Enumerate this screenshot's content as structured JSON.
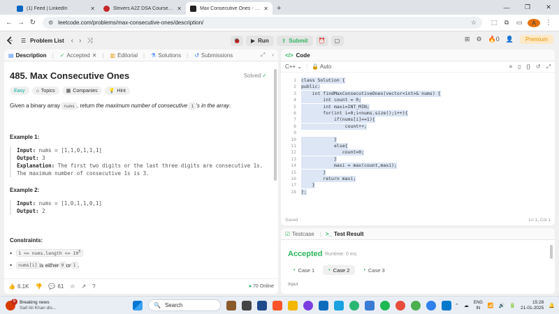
{
  "browser": {
    "tabs": [
      {
        "title": "(1) Feed | LinkedIn",
        "color": "#0a66c2"
      },
      {
        "title": "Strivers A2Z DSA Course/Sheet",
        "color": "#c62828"
      },
      {
        "title": "Max Consecutive Ones - LeetCo",
        "color": "#222222"
      }
    ],
    "url": "leetcode.com/problems/max-consecutive-ones/description/",
    "profile_initial": "A"
  },
  "nav": {
    "problem_list": "Problem List",
    "run": "Run",
    "submit": "Submit",
    "fire_count": "0",
    "premium": "Premium"
  },
  "left_tabs": {
    "description": "Description",
    "accepted": "Accepted",
    "editorial": "Editorial",
    "solutions": "Solutions",
    "submissions": "Submissions"
  },
  "problem": {
    "title": "485. Max Consecutive Ones",
    "status": "Solved",
    "difficulty": "Easy",
    "topics": "Topics",
    "companies": "Companies",
    "hint": "Hint",
    "desc_pre": "Given a binary array ",
    "desc_code": "nums",
    "desc_mid": ", return ",
    "desc_italic_a": "the maximum number of consecutive ",
    "desc_code2": "1",
    "desc_italic_b": "'s in the array",
    "desc_end": ".",
    "example1_title": "Example 1:",
    "example1_input_label": "Input:",
    "example1_input": " nums = [1,1,0,1,1,1]",
    "example1_output_label": "Output:",
    "example1_output": " 3",
    "example1_expl_label": "Explanation:",
    "example1_expl1": " The first two digits or the last three digits are consecutive 1s.",
    "example1_expl2": "The maximum number of consecutive 1s is 3.",
    "example2_title": "Example 2:",
    "example2_input_label": "Input:",
    "example2_input": " nums = [1,0,1,1,0,1]",
    "example2_output_label": "Output:",
    "example2_output": " 2",
    "constraints_title": "Constraints:",
    "constraint1": "1 <= nums.length <= 10",
    "constraint1_exp": "5",
    "constraint2_code": "nums[i]",
    "constraint2_mid": " is either ",
    "constraint2_a": "0",
    "constraint2_or": " or ",
    "constraint2_b": "1",
    "constraint2_end": "."
  },
  "footer": {
    "likes": "6.1K",
    "comments": "61",
    "online": "70 Online"
  },
  "editor": {
    "header": "Code",
    "language": "C++",
    "mode": "Auto",
    "saved": "Saved",
    "cursor": "Ln 1, Col 1",
    "lines": [
      "class Solution {",
      "public:",
      "    int findMaxConsecutiveOnes(vector<int>& nums) {",
      "        int count = 0;",
      "        int maxi=INT_MIN;",
      "        for(int i=0;i<nums.size();i++){",
      "            if(nums[i]==1){",
      "                count++;",
      "",
      "            }",
      "            else{",
      "               count=0;",
      "            }",
      "            maxi = max(count,maxi);",
      "        }",
      "        return maxi;",
      "    }",
      "};"
    ]
  },
  "testpanel": {
    "testcase": "Testcase",
    "test_result": "Test Result",
    "accepted": "Accepted",
    "runtime": "Runtime: 0 ms",
    "cases": [
      "Case 1",
      "Case 2",
      "Case 3"
    ],
    "input_label": "Input"
  },
  "taskbar": {
    "news_count": "5",
    "news_title": "Breaking news",
    "news_sub": "Saif Ali Khan dis...",
    "search": "Search",
    "lang1": "ENG",
    "lang2": "IN",
    "time": "15:28",
    "date": "21-01-2025"
  }
}
